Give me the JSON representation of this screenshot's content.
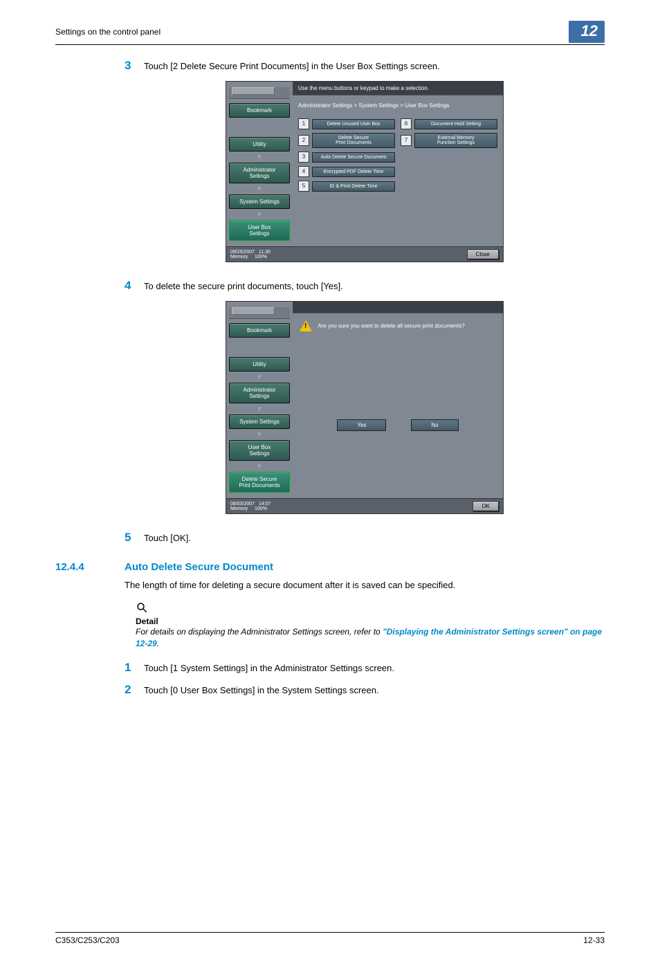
{
  "header": {
    "title": "Settings on the control panel",
    "chapter": "12"
  },
  "steps": {
    "s3": {
      "num": "3",
      "text": "Touch [2 Delete Secure Print Documents] in the User Box Settings screen."
    },
    "s4": {
      "num": "4",
      "text": "To delete the secure print documents, touch [Yes]."
    },
    "s5": {
      "num": "5",
      "text": "Touch [OK]."
    },
    "p1": {
      "num": "1",
      "text": "Touch [1 System Settings] in the Administrator Settings screen."
    },
    "p2": {
      "num": "2",
      "text": "Touch [0 User Box Settings] in the System Settings screen."
    }
  },
  "panel1": {
    "instr": "Use the menu buttons or keypad to make a selection.",
    "breadcrumb": "Administrator Settings > System Settings > User Box Settings",
    "sidebar": {
      "bookmark": "Bookmark",
      "utility": "Utility",
      "admin": "Administrator\nSettings",
      "system": "System Settings",
      "userbox": "User Box\nSettings"
    },
    "left": [
      {
        "n": "1",
        "label": "Delete Unused User Box"
      },
      {
        "n": "2",
        "label": "Delete Secure\nPrint Documents"
      },
      {
        "n": "3",
        "label": "Auto Delete Secure Document"
      },
      {
        "n": "4",
        "label": "Encrypted PDF Delete Time"
      },
      {
        "n": "5",
        "label": "ID & Print Delete Time"
      }
    ],
    "right": [
      {
        "n": "6",
        "label": "Document Hold Setting"
      },
      {
        "n": "7",
        "label": "External Memory\nFunction Settings"
      }
    ],
    "status": {
      "date": "09/25/2007",
      "time": "11:30",
      "mem_label": "Memory",
      "mem_val": "100%",
      "close": "Close"
    }
  },
  "panel2": {
    "confirm": "Are you sure you want to delete all secure print documents?",
    "yes": "Yes",
    "no": "No",
    "sidebar_extra": "Delete Secure\nPrint Documents",
    "status": {
      "date": "08/03/2007",
      "time": "14:07",
      "mem_label": "Memory",
      "mem_val": "100%",
      "ok": "OK"
    }
  },
  "section": {
    "num": "12.4.4",
    "title": "Auto Delete Secure Document",
    "intro": "The length of time for deleting a secure document after it is saved can be specified."
  },
  "detail": {
    "label": "Detail",
    "text_pre": "For details on displaying the Administrator Settings screen, refer to ",
    "link": "\"Displaying the Administrator Settings screen\" on page 12-29",
    "text_post": "."
  },
  "footer": {
    "left": "C353/C253/C203",
    "right": "12-33"
  }
}
